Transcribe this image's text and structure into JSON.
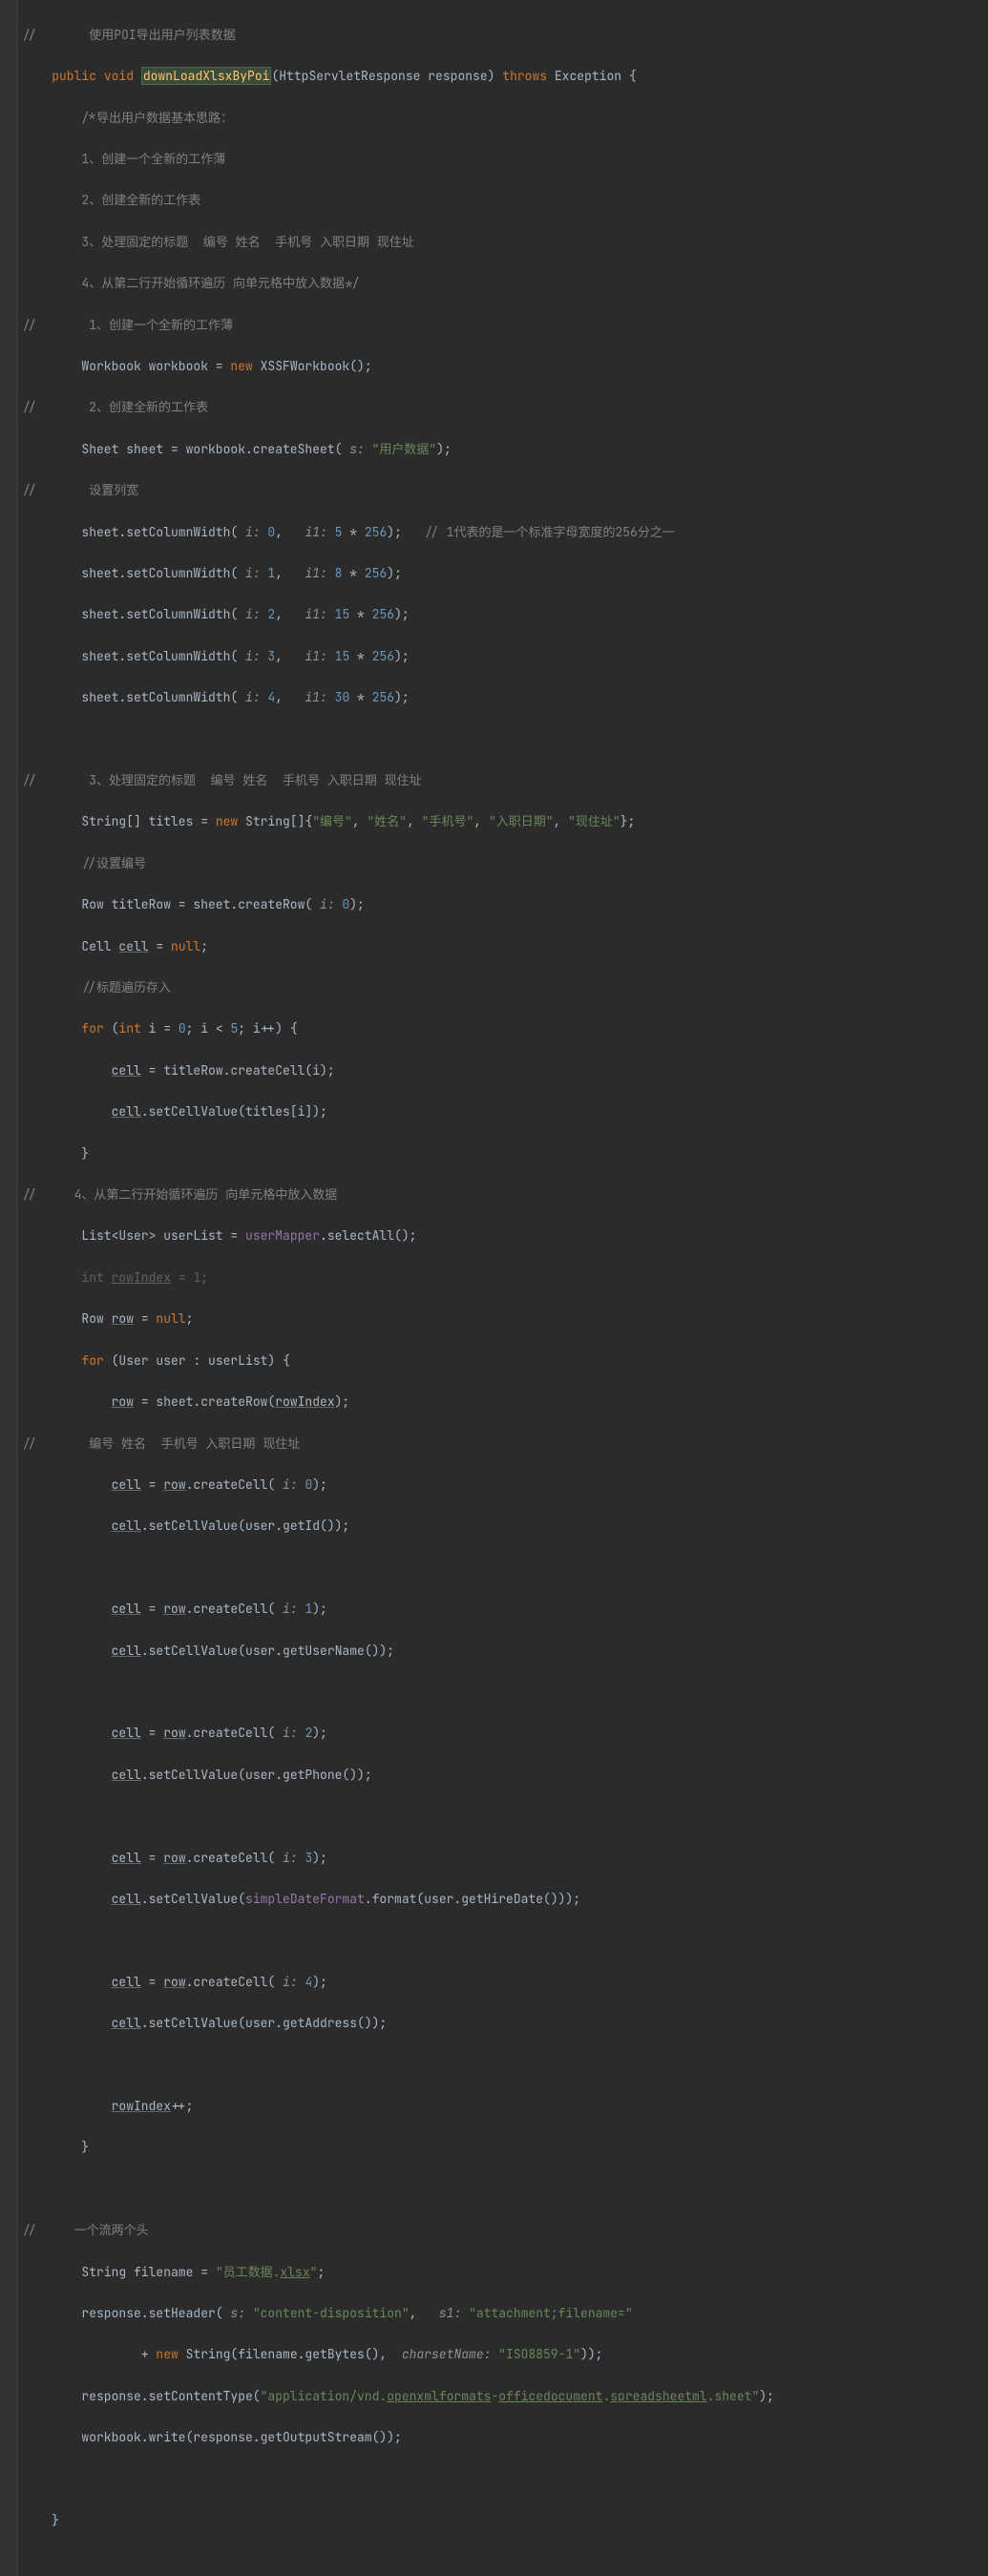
{
  "lines": {
    "l1_cmt": "//       使用POI导出用户列表数据",
    "l2_public": "public",
    "l2_void": "void",
    "l2_method": "downLoadXlsxByPoi",
    "l2_params": "(HttpServletResponse response) ",
    "l2_throws": "throws",
    "l2_exc": " Exception {",
    "l3": "/*导出用户数据基本思路：",
    "l4": "1、创建一个全新的工作薄",
    "l5": "2、创建全新的工作表",
    "l6": "3、处理固定的标题  编号 姓名  手机号 入职日期 现住址",
    "l7": "4、从第二行开始循环遍历 向单元格中放入数据*/",
    "l8": "//       1、创建一个全新的工作薄",
    "l9a": "Workbook workbook = ",
    "l9_new": "new",
    "l9b": " XSSFWorkbook();",
    "l10": "//       2、创建全新的工作表",
    "l11a": "Sheet sheet = workbook.createSheet( ",
    "l11_p": "s:",
    "l11_s": " \"用户数据\"",
    "l11b": ");",
    "l12": "//       设置列宽",
    "l13a": "sheet.setColumnWidth( ",
    "l13_p1": "i:",
    "l13_n1": " 0",
    "l13m": ",   ",
    "l13_p2": "i1:",
    "l13_n2": " 5",
    "l13b": " * ",
    "l13_n3": "256",
    "l13c": ");   ",
    "l13_cmt": "// 1代表的是一个标准字母宽度的256分之一",
    "scw_n1_1": " 1",
    "scw_n2_8": " 8",
    "scw_n1_2": " 2",
    "scw_n2_15": " 15",
    "scw_n1_3": " 3",
    "scw_n1_4": " 4",
    "scw_n2_30": " 30",
    "l19": "//       3、处理固定的标题  编号 姓名  手机号 入职日期 现住址",
    "l20a": "String[] titles = ",
    "l20_new": "new",
    "l20b": " String[]{",
    "l20_s1": "\"编号\"",
    "l20_s2": "\"姓名\"",
    "l20_s3": "\"手机号\"",
    "l20_s4": "\"入职日期\"",
    "l20_s5": "\"现住址\"",
    "l20c": "};",
    "l21": "//设置编号",
    "l22a": "Row titleRow = sheet.createRow( ",
    "l22_p": "i:",
    "l22_n": " 0",
    "l22b": ");",
    "l23a": "Cell ",
    "l23_cell": "cell",
    "l23b": " = ",
    "l23_null": "null",
    "l23c": ";",
    "l24": "//标题遍历存入",
    "l25_for": "for",
    "l25a": " (",
    "l25_int": "int",
    "l25b": " i = ",
    "l25_n0": "0",
    "l25c": "; i < ",
    "l25_n5": "5",
    "l25d": "; i++) {",
    "l26_cell": "cell",
    "l26a": " = titleRow.createCell(i);",
    "l27_cell": "cell",
    "l27a": ".setCellValue(titles[i]);",
    "l28": "}",
    "l29": "//     4、从第二行开始循环遍历 向单元格中放入数据",
    "l30a": "List<User> userList = ",
    "l30_f": "userMapper",
    "l30b": ".selectAll();",
    "l31a": "int ",
    "l31_ri": "rowIndex",
    "l31b": " = ",
    "l31_n": "1",
    "l31c": ";",
    "l32a": "Row ",
    "l32_row": "row",
    "l32b": " = ",
    "l32_null": "null",
    "l32c": ";",
    "l33_for": "for",
    "l33a": " (User user : userList) {",
    "l34_row": "row",
    "l34a": " = sheet.createRow(",
    "l34_ri": "rowIndex",
    "l34b": ");",
    "l35": "//       编号 姓名  手机号 入职日期 现住址",
    "cc_cell": "cell",
    "cc_eq": " = ",
    "cc_row": "row",
    "cc_a": ".createCell( ",
    "cc_p": "i:",
    "cc_n0": " 0",
    "cc_n1": " 1",
    "cc_n2": " 2",
    "cc_n3": " 3",
    "cc_n4": " 4",
    "cc_b": ");",
    "scv_cell": "cell",
    "scv_getid": ".setCellValue(user.getId());",
    "scv_getun": ".setCellValue(user.getUserName());",
    "scv_getph": ".setCellValue(user.getPhone());",
    "scv_date_a": ".setCellValue(",
    "scv_date_f": "simpleDateFormat",
    "scv_date_b": ".format(user.getHireDate()));",
    "scv_getaddr": ".setCellValue(user.getAddress());",
    "l_riinc": "rowIndex",
    "l_riinc_b": "++;",
    "l_cb": "}",
    "l_flow_cmt": "//     一个流两个头",
    "fn_a": "String filename = ",
    "fn_s1": "\"员工数据.",
    "fn_s2": "xlsx",
    "fn_s3": "\"",
    "fn_b": ";",
    "sh_a": "response.setHeader( ",
    "sh_p1": "s:",
    "sh_s1": " \"content-disposition\"",
    "sh_m": ",   ",
    "sh_p2": "s1:",
    "sh_s2": " \"attachment;filename=\"",
    "sh2_a": "+ ",
    "sh2_new": "new",
    "sh2_b": " String(filename.getBytes(),  ",
    "sh2_p": "charsetName:",
    "sh2_s": " \"ISO8859-1\"",
    "sh2_c": "));",
    "ct_a": "response.setContentType(",
    "ct_s1": "\"application/vnd.",
    "ct_s2": "openxmlformats",
    "ct_s3": "-",
    "ct_s4": "officedocument",
    "ct_s5": ".",
    "ct_s6": "spreadsheetml",
    "ct_s7": ".sheet\"",
    "ct_b": ");",
    "wr": "workbook.write(response.getOutputStream());",
    "end_cb": "}"
  }
}
